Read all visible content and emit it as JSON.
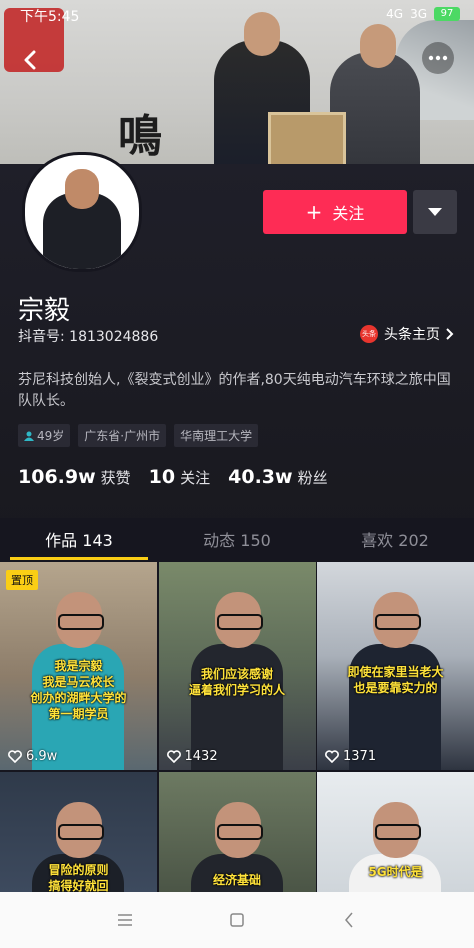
{
  "status_bar": {
    "time": "下午5:45",
    "signal_1": "4G",
    "signal_2": "3G",
    "battery": "97"
  },
  "profile": {
    "name": "宗毅",
    "douyin_id": "抖音号: 1813024886",
    "toutiao_link": "头条主页",
    "toutiao_badge": "头条",
    "bio": "芬尼科技创始人,《裂变式创业》的作者,80天纯电动汽车环球之旅中国队队长。",
    "tags": [
      "49岁",
      "广东省·广州市",
      "华南理工大学"
    ]
  },
  "actions": {
    "follow_label": "关注"
  },
  "stats": [
    {
      "value": "106.9w",
      "label": "获赞"
    },
    {
      "value": "10",
      "label": "关注"
    },
    {
      "value": "40.3w",
      "label": "粉丝"
    }
  ],
  "tabs": [
    {
      "label": "作品 143"
    },
    {
      "label": "动态 150"
    },
    {
      "label": "喜欢 202"
    }
  ],
  "videos": [
    {
      "caption": "我是宗毅\n我是马云校长\n创办的湖畔大学的\n第一期学员",
      "likes": "6.9w",
      "pinned_label": "置顶"
    },
    {
      "caption": "我们应该感谢\n逼着我们学习的人",
      "likes": "1432"
    },
    {
      "caption": "即使在家里当老大\n也是要靠实力的",
      "likes": "1371"
    },
    {
      "caption": "冒险的原则\n搞得好就回"
    },
    {
      "caption": "经济基础"
    },
    {
      "caption": "5G时代是"
    }
  ],
  "colors": {
    "accent": "#fe2c55",
    "tab_indicator": "#face15",
    "caption": "#ffe23a"
  }
}
